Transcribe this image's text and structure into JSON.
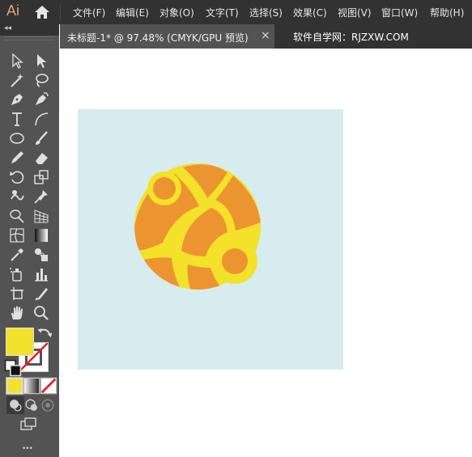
{
  "app": {
    "logo": "Ai"
  },
  "menu": {
    "items": [
      "文件(F)",
      "编辑(E)",
      "对象(O)",
      "文字(T)",
      "选择(S)",
      "效果(C)",
      "视图(V)",
      "窗口(W)",
      "帮助(H)"
    ]
  },
  "document": {
    "tab_title": "未标题-1* @ 97.48% (CMYK/GPU 预览)",
    "close_glyph": "×",
    "watermark": "软件自学网：RJZXW.COM"
  },
  "toolbar": {
    "collapse_glyph": "◂◂",
    "more_glyph": "•••",
    "tools": [
      "selection-tool",
      "direct-selection-tool",
      "magic-wand-tool",
      "lasso-tool",
      "pen-tool",
      "curvature-tool",
      "type-tool",
      "arc-tool",
      "ellipse-tool",
      "paintbrush-tool",
      "pencil-tool",
      "eraser-tool",
      "rotate-tool",
      "scale-tool",
      "warp-tool",
      "puppet-warp-tool",
      "shape-builder-tool",
      "perspective-grid-tool",
      "mesh-tool",
      "gradient-tool",
      "eyedropper-tool",
      "blend-tool",
      "symbol-sprayer-tool",
      "column-graph-tool",
      "artboard-tool",
      "slice-tool",
      "hand-tool",
      "zoom-tool"
    ]
  },
  "colors": {
    "fill": "#f1e22b",
    "artboard": "#d7ecef",
    "planet_orange": "#ec9530",
    "planet_yellow": "#f3e12a"
  }
}
